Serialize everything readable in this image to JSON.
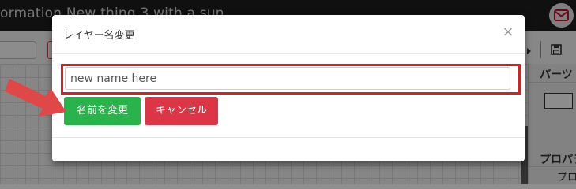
{
  "app": {
    "title": "ormation  New thing 3 with a sun..."
  },
  "right_panel": {
    "parts_heading": "パーツ",
    "properties_heading": "プロパテ",
    "properties_sub": "プロ"
  },
  "dialog": {
    "title": "レイヤー名変更",
    "close_glyph": "×",
    "input": {
      "value": "",
      "placeholder": "new name here"
    },
    "rename_button": "名前を変更",
    "cancel_button": "キャンセル"
  },
  "colors": {
    "highlight": "#d9201f",
    "rename_button": "#28b44a",
    "cancel_button": "#dc3545",
    "annotation_arrow": "#e04848"
  },
  "icons": [
    "mail-icon",
    "save-icon",
    "close-icon",
    "arrow-annotation"
  ]
}
